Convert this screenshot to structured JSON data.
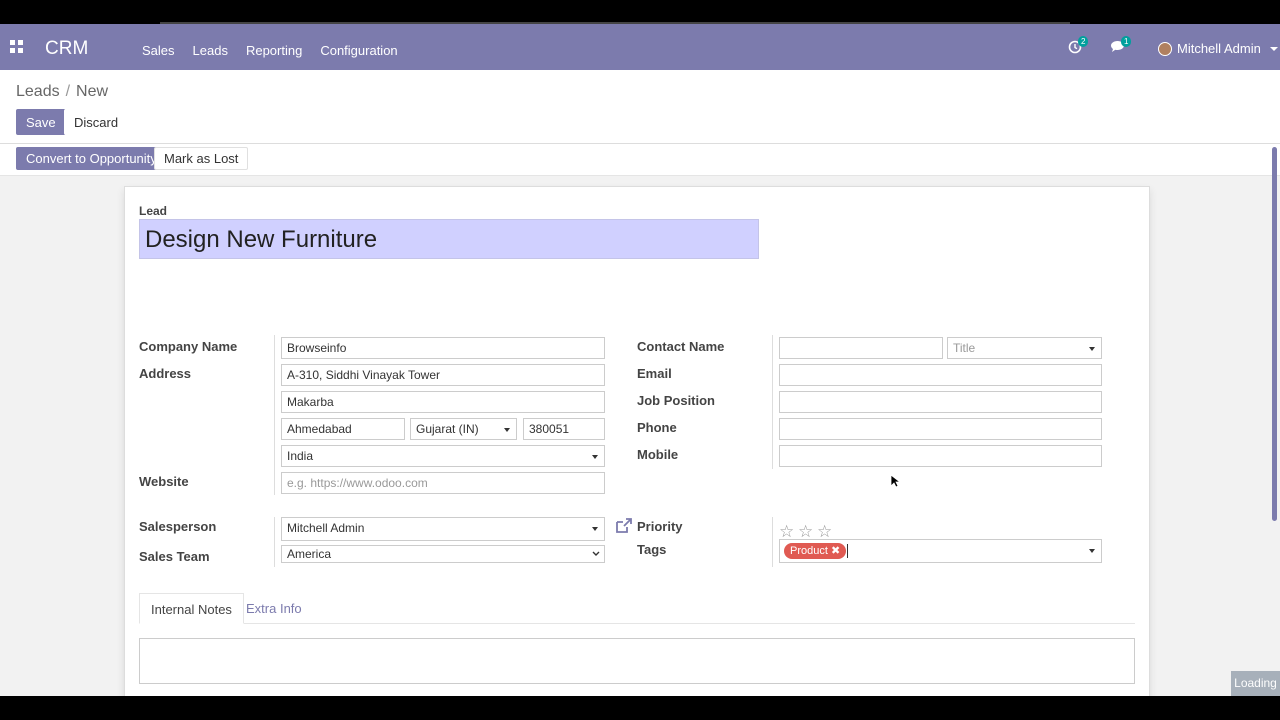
{
  "app": {
    "brand": "CRM"
  },
  "navbar": {
    "menu": [
      "Sales",
      "Leads",
      "Reporting",
      "Configuration"
    ],
    "activity_count": "2",
    "messages_count": "1",
    "user": "Mitchell Admin"
  },
  "breadcrumb": {
    "parent": "Leads",
    "separator": "/",
    "current": "New"
  },
  "buttons": {
    "save": "Save",
    "discard": "Discard",
    "convert": "Convert to Opportunity",
    "mark_lost": "Mark as Lost"
  },
  "form": {
    "lead_label": "Lead",
    "lead_name": "Design New Furniture",
    "labels": {
      "company_name": "Company Name",
      "address": "Address",
      "website": "Website",
      "salesperson": "Salesperson",
      "sales_team": "Sales Team",
      "contact_name": "Contact Name",
      "email": "Email",
      "job_position": "Job Position",
      "phone": "Phone",
      "mobile": "Mobile",
      "priority": "Priority",
      "tags": "Tags"
    },
    "values": {
      "company_name": "Browseinfo",
      "street": "A-310, Siddhi Vinayak Tower",
      "street2": "Makarba",
      "city": "Ahmedabad",
      "state": "Gujarat (IN)",
      "zip": "380051",
      "country": "India",
      "website_placeholder": "e.g. https://www.odoo.com",
      "salesperson": "Mitchell Admin",
      "sales_team": "America",
      "contact_name": "",
      "title_placeholder": "Title",
      "email": "",
      "job_position": "",
      "phone": "",
      "mobile": "",
      "priority_stars": 0,
      "tag": "Product"
    },
    "tabs": [
      "Internal Notes",
      "Extra Info"
    ]
  },
  "status": {
    "loading": "Loading"
  },
  "colors": {
    "brand": "#7c7bad",
    "tag": "#e05a52",
    "title_highlight": "#d0d0ff"
  }
}
